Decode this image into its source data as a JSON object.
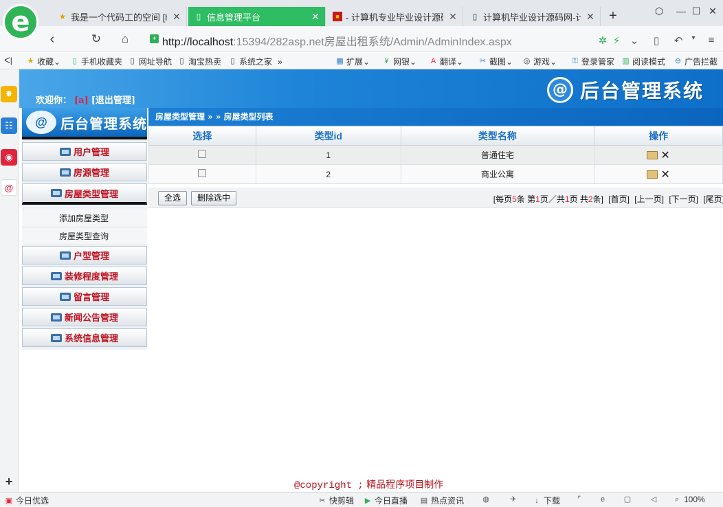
{
  "browser": {
    "tabs": [
      {
        "title": "我是一个代码工的空间 [ht",
        "icon": "star-icon",
        "active": false
      },
      {
        "title": "信息管理平台",
        "icon": "page-icon",
        "active": true
      },
      {
        "title": "- 计算机专业毕业设计源码",
        "icon": "red-box-icon",
        "active": false
      },
      {
        "title": "计算机毕业设计源码网-计",
        "icon": "page-icon",
        "active": false
      }
    ],
    "new_tab": "+",
    "url_host": "http://localhost",
    "url_path": ":15394/282asp.net房屋出租系统/Admin/AdminIndex.aspx",
    "bookmarks": [
      {
        "label": "收藏",
        "icon": "star-icon"
      },
      {
        "label": "手机收藏夹",
        "icon": "phone-icon"
      },
      {
        "label": "网址导航",
        "icon": "page-icon"
      },
      {
        "label": "淘宝热卖",
        "icon": "page-icon"
      },
      {
        "label": "系统之家",
        "icon": "page-icon"
      },
      {
        "label": "扩展",
        "icon": "grid-icon"
      },
      {
        "label": "网银",
        "icon": "yuan-icon"
      },
      {
        "label": "翻译",
        "icon": "translate-icon"
      },
      {
        "label": "截图",
        "icon": "scissors-icon"
      },
      {
        "label": "游戏",
        "icon": "gamepad-icon"
      },
      {
        "label": "登录管家",
        "icon": "key-icon"
      },
      {
        "label": "阅读模式",
        "icon": "book-icon"
      },
      {
        "label": "广告拦截",
        "icon": "block-icon"
      }
    ],
    "statusbar": {
      "left": "今日优选",
      "items": [
        "快剪辑",
        "今日直播",
        "热点资讯",
        "下载"
      ],
      "zoom": "100%"
    }
  },
  "app": {
    "welcome_prefix": "欢迎你：",
    "user": "[a]",
    "logout": "[退出管理]",
    "brand_title": "后台管理系统",
    "left_brand_title": "后台管理系统",
    "menu": [
      {
        "label": "用户管理"
      },
      {
        "label": "房源管理"
      },
      {
        "label": "房屋类型管理",
        "open": true,
        "children": [
          "添加房屋类型",
          "房屋类型查询"
        ]
      },
      {
        "label": "户型管理"
      },
      {
        "label": "装修程度管理"
      },
      {
        "label": "留言管理"
      },
      {
        "label": "新闻公告管理"
      },
      {
        "label": "系统信息管理"
      }
    ],
    "breadcrumb": "房屋类型管理 » » 房屋类型列表",
    "table": {
      "headers": [
        "选择",
        "类型id",
        "类型名称",
        "操作"
      ],
      "rows": [
        {
          "id": "1",
          "name": "普通住宅"
        },
        {
          "id": "2",
          "name": "商业公寓"
        }
      ]
    },
    "select_all": "全选",
    "delete_selected": "删除选中",
    "pager": {
      "per_page_prefix": "[每页",
      "per_page": "5",
      "per_page_suffix": "条 第",
      "current": "1",
      "current_suffix": "页／共",
      "total_pages": "1",
      "total_pages_suffix": "页 共",
      "total": "2",
      "total_suffix": "条]",
      "first": "[首页]",
      "prev": "[上一页]",
      "next": "[下一页]",
      "last": "[尾页]"
    },
    "footer_copyright": "@copyright ;",
    "footer_text": "精品程序项目制作"
  },
  "colors": {
    "active_tab": "#2ebd62",
    "header_blue": "#1e84d8",
    "menu_red": "#c0101e",
    "table_header_text": "#1a6fc6"
  }
}
